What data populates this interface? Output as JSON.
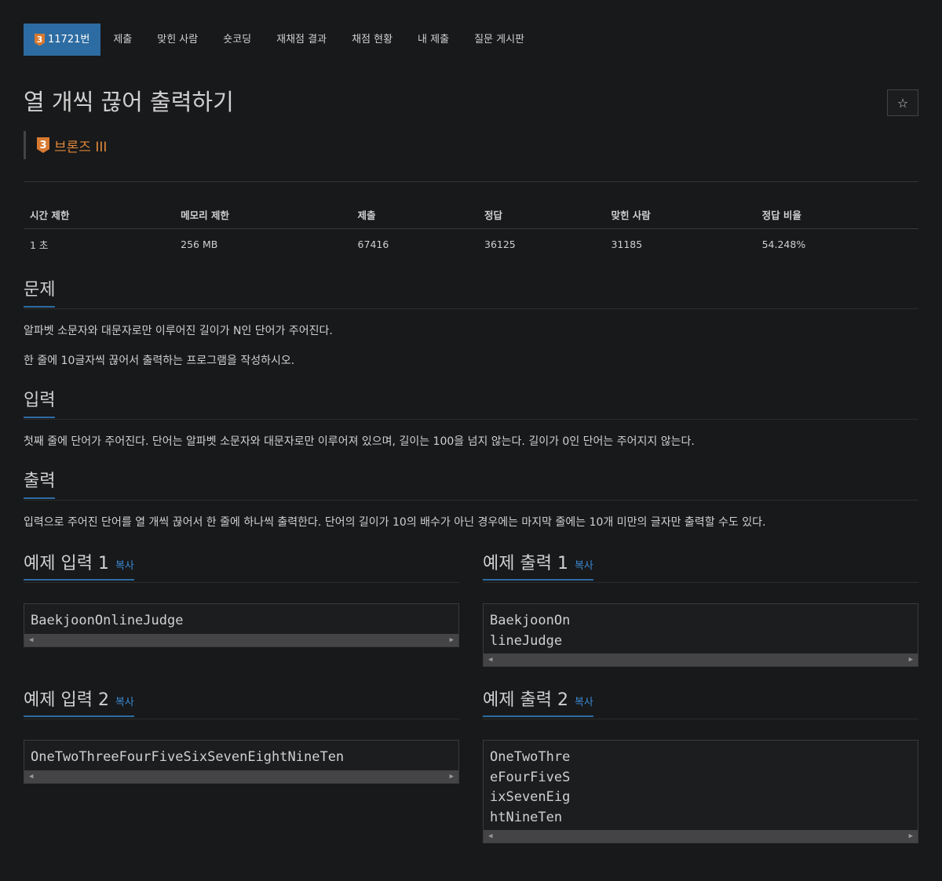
{
  "tabs": {
    "problem_tier_level": "3",
    "problem_number": "11721번",
    "submit": "제출",
    "solvers": "맞힌 사람",
    "shortcoding": "숏코딩",
    "rejudge": "재채점 결과",
    "status": "채점 현황",
    "my_submissions": "내 제출",
    "board": "질문 게시판"
  },
  "problem": {
    "title": "열 개씩 끊어 출력하기",
    "star_icon": "☆",
    "tier_level": "3",
    "tier_label": "브론즈 III",
    "tier_color": "#e0883a"
  },
  "info_table": {
    "headers": [
      "시간 제한",
      "메모리 제한",
      "제출",
      "정답",
      "맞힌 사람",
      "정답 비율"
    ],
    "values": [
      "1 초",
      "256 MB",
      "67416",
      "36125",
      "31185",
      "54.248%"
    ]
  },
  "sections": {
    "problem_heading": "문제",
    "problem_text_1": "알파벳 소문자와 대문자로만 이루어진 길이가 N인 단어가 주어진다.",
    "problem_text_2": "한 줄에 10글자씩 끊어서 출력하는 프로그램을 작성하시오.",
    "input_heading": "입력",
    "input_text": "첫째 줄에 단어가 주어진다. 단어는 알파벳 소문자와 대문자로만 이루어져 있으며, 길이는 100을 넘지 않는다. 길이가 0인 단어는 주어지지 않는다.",
    "output_heading": "출력",
    "output_text": "입력으로 주어진 단어를 열 개씩 끊어서 한 줄에 하나씩 출력한다. 단어의 길이가 10의 배수가 아닌 경우에는 마지막 줄에는 10개 미만의 글자만 출력할 수도 있다."
  },
  "examples": {
    "copy_label": "복사",
    "input1_title": "예제 입력 1",
    "input1_code": "BaekjoonOnlineJudge",
    "output1_title": "예제 출력 1",
    "output1_code": "BaekjoonOn\nlineJudge",
    "input2_title": "예제 입력 2",
    "input2_code": "OneTwoThreeFourFiveSixSevenEightNineTen",
    "output2_title": "예제 출력 2",
    "output2_code": "OneTwoThre\neFourFiveS\nixSevenEig\nhtNineTen"
  },
  "colors": {
    "accent": "#2d6ca2",
    "link": "#3a8ad2",
    "background": "#18191b"
  }
}
